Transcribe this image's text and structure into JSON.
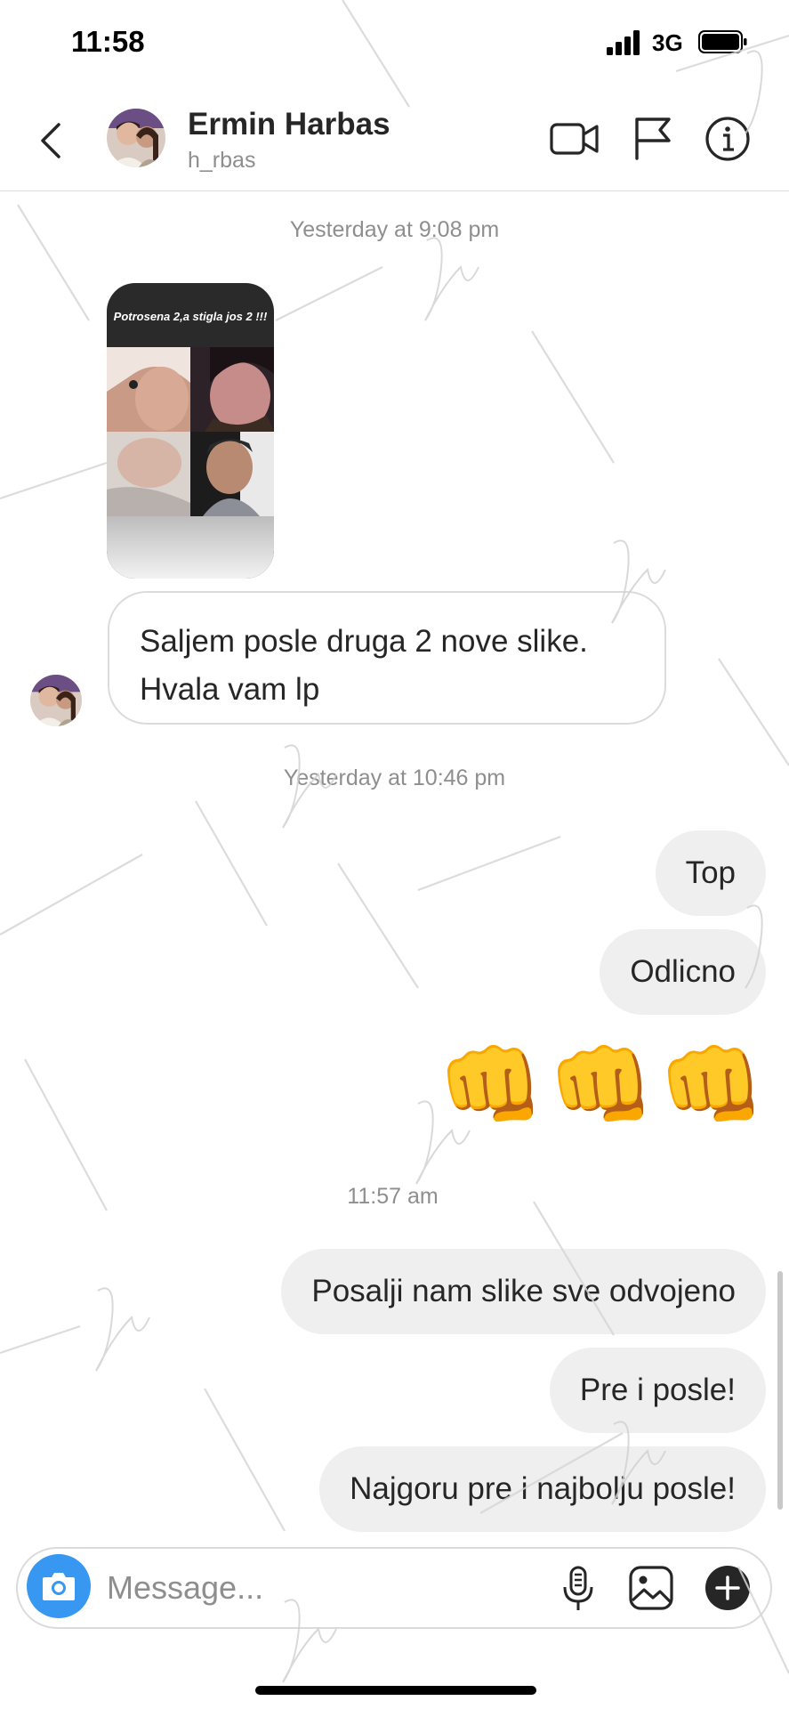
{
  "status_bar": {
    "time": "11:58",
    "network": "3G"
  },
  "header": {
    "name": "Ermin Harbas",
    "username": "h_rbas"
  },
  "icons": {
    "back": "chevron-left-icon",
    "video": "video-camera-icon",
    "flag": "flag-icon",
    "info": "info-icon",
    "camera": "camera-icon",
    "mic": "microphone-icon",
    "gallery": "image-icon",
    "plus": "plus-icon"
  },
  "thread": {
    "ts1": "Yesterday at 9:08 pm",
    "story_caption": "Potrosena 2,a stigla jos 2 !!!",
    "incoming_message": [
      "Saljem posle druga 2 nove slike.",
      "Hvala vam lp"
    ],
    "ts2": "Yesterday at 10:46 pm",
    "out1": "Top",
    "out2": "Odlicno",
    "emoji": [
      "👊",
      "👊",
      "👊"
    ],
    "ts3": "11:57 am",
    "out3": "Posalji nam slike sve odvojeno",
    "out4": "Pre i posle!",
    "out5": "Najgoru pre i najbolju posle!"
  },
  "composer": {
    "placeholder": "Message..."
  },
  "colors": {
    "accent": "#3897f0",
    "bubble_out": "#efefef",
    "border": "#dbdbdb",
    "meta": "#8e8e8e"
  }
}
